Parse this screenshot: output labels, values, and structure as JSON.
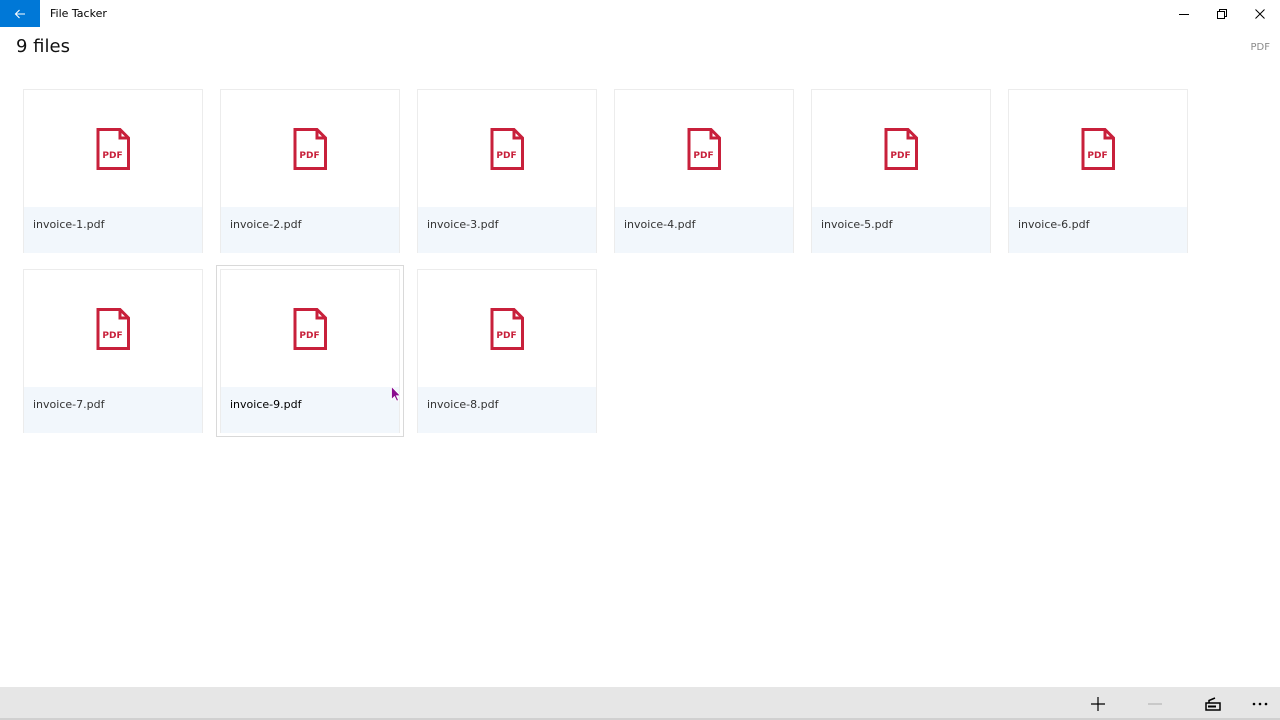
{
  "window": {
    "title": "File Tacker"
  },
  "header": {
    "count_label": "9 files",
    "filter_label": "PDF"
  },
  "icon_text": "PDF",
  "files": [
    {
      "name": "invoice-1.pdf"
    },
    {
      "name": "invoice-2.pdf"
    },
    {
      "name": "invoice-3.pdf"
    },
    {
      "name": "invoice-4.pdf"
    },
    {
      "name": "invoice-5.pdf"
    },
    {
      "name": "invoice-6.pdf"
    },
    {
      "name": "invoice-7.pdf"
    },
    {
      "name": "invoice-9.pdf",
      "selected": true
    },
    {
      "name": "invoice-8.pdf"
    }
  ],
  "colors": {
    "accent": "#0078d7",
    "pdf_red": "#c8203b",
    "caption_bg": "#f2f7fc",
    "command_bar": "#e6e6e6"
  },
  "command_bar_icons": [
    "add-icon",
    "remove-icon",
    "scanner-icon",
    "more-icon"
  ]
}
